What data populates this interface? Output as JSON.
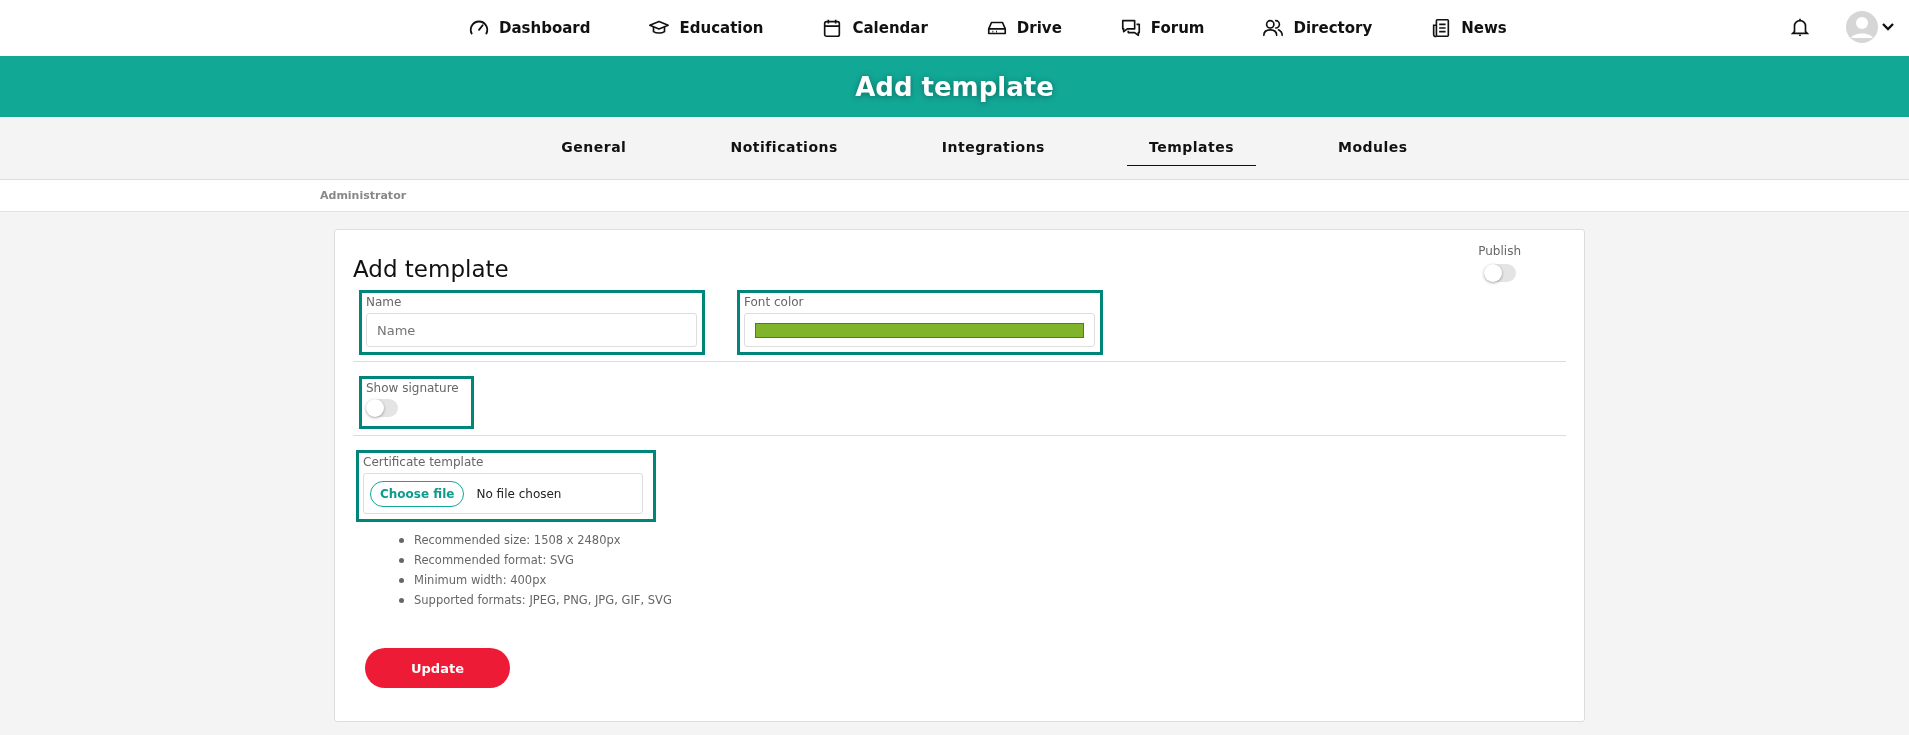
{
  "top_nav": [
    {
      "kind": "dashboard",
      "label": "Dashboard"
    },
    {
      "kind": "education",
      "label": "Education"
    },
    {
      "kind": "calendar",
      "label": "Calendar"
    },
    {
      "kind": "drive",
      "label": "Drive"
    },
    {
      "kind": "forum",
      "label": "Forum"
    },
    {
      "kind": "directory",
      "label": "Directory"
    },
    {
      "kind": "news",
      "label": "News"
    }
  ],
  "banner": {
    "title": "Add template"
  },
  "tabs": [
    {
      "label": "General",
      "selected": false
    },
    {
      "label": "Notifications",
      "selected": false
    },
    {
      "label": "Integrations",
      "selected": false
    },
    {
      "label": "Templates",
      "selected": true
    },
    {
      "label": "Modules",
      "selected": false
    }
  ],
  "breadcrumb": "Administrator",
  "form": {
    "title": "Add template",
    "publish": {
      "label": "Publish",
      "on": false
    },
    "name": {
      "label": "Name",
      "placeholder": "Name"
    },
    "font_color": {
      "label": "Font color",
      "color": "#80b42a"
    },
    "show_signature": {
      "label": "Show signature",
      "on": false
    },
    "certificate": {
      "label": "Certificate template",
      "button": "Choose file",
      "status": "No file chosen"
    },
    "hints": [
      "Recommended size: 1508 x 2480px",
      "Recommended format: SVG",
      "Minimum width: 400px",
      "Supported formats: JPEG, PNG, JPG, GIF, SVG"
    ],
    "submit": "Update"
  }
}
